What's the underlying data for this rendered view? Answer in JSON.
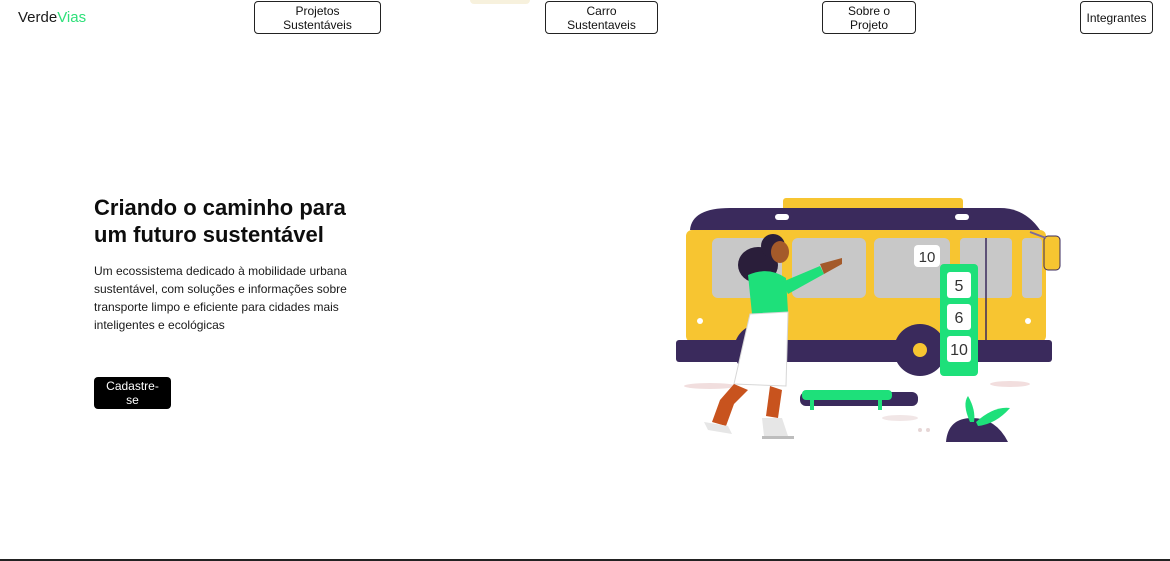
{
  "brand": {
    "part1": "Verde",
    "part2": "Vias",
    "accent_color": "#2fe07a"
  },
  "nav": {
    "items": [
      {
        "label": "Projetos Sustentáveis"
      },
      {
        "label": "Carro Sustentaveis"
      },
      {
        "label": "Sobre o Projeto"
      },
      {
        "label": "Integrantes"
      }
    ]
  },
  "hero": {
    "title": "Criando o caminho para um futuro sustentável",
    "description": "Um ecossistema dedicado à mobilidade urbana sustentável, com soluções e informações sobre transporte limpo e eficiente para cidades mais inteligentes e ecológicas",
    "cta_label": "Cadastre-se"
  },
  "illustration": {
    "bus_number": "10",
    "stop_sign_numbers": [
      "5",
      "6",
      "10"
    ],
    "colors": {
      "bus_body": "#f7c531",
      "bus_roof": "#3a2a5c",
      "green": "#1ee07a",
      "window": "#c8c8c8"
    }
  }
}
